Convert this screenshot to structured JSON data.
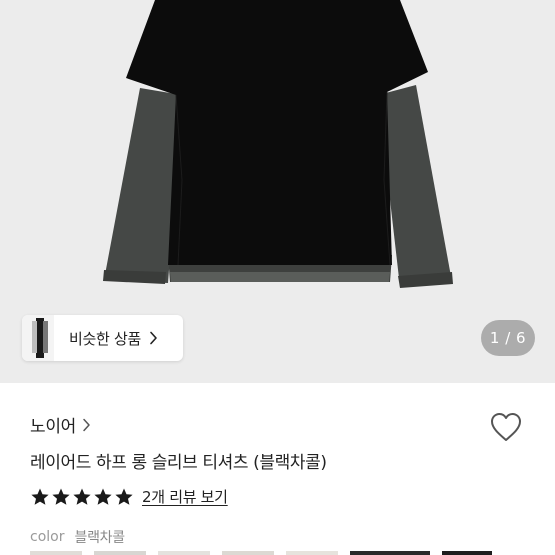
{
  "gallery": {
    "page_counter": "1 / 6",
    "similar_products_label": "비슷한 상품",
    "colors": {
      "background": "#ececec",
      "body": "#0c0c0c",
      "sleeve": "#454846",
      "hem": "#3e403e"
    }
  },
  "product": {
    "brand": "노이어",
    "title": "레이어드 하프 롱 슬리브 티셔츠 (블랙차콜)",
    "rating_stars": 5,
    "review_link": "2개 리뷰 보기",
    "option_label": "color",
    "option_value": "블랙차콜"
  },
  "icons": {
    "wishlist": "heart-outline-icon",
    "brand_chevron": "chevron-right-icon",
    "similar_chevron": "chevron-right-icon",
    "star": "star-filled-icon"
  }
}
